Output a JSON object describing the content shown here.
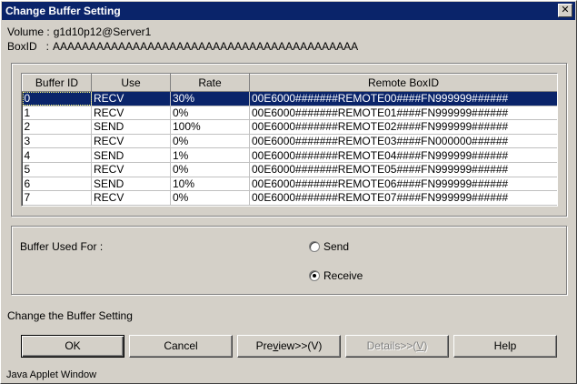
{
  "window": {
    "title": "Change Buffer Setting",
    "close_glyph": "✕"
  },
  "info": {
    "volume_label": "Volume :",
    "volume_value": "g1d10p12@Server1",
    "boxid_label": "BoxID   :",
    "boxid_value": "AAAAAAAAAAAAAAAAAAAAAAAAAAAAAAAAAAAAAAAAAA"
  },
  "table": {
    "columns": [
      "Buffer ID",
      "Use",
      "Rate",
      "Remote BoxID"
    ],
    "rows": [
      [
        "0",
        "RECV",
        "30%",
        "00E6000#######REMOTE00####FN999999######"
      ],
      [
        "1",
        "RECV",
        "0%",
        "00E6000#######REMOTE01####FN999999######"
      ],
      [
        "2",
        "SEND",
        "100%",
        "00E6000#######REMOTE02####FN999999######"
      ],
      [
        "3",
        "RECV",
        "0%",
        "00E6000#######REMOTE03####FN000000######"
      ],
      [
        "4",
        "SEND",
        "1%",
        "00E6000#######REMOTE04####FN999999######"
      ],
      [
        "5",
        "RECV",
        "0%",
        "00E6000#######REMOTE05####FN999999######"
      ],
      [
        "6",
        "SEND",
        "10%",
        "00E6000#######REMOTE06####FN999999######"
      ],
      [
        "7",
        "RECV",
        "0%",
        "00E6000#######REMOTE07####FN999999######"
      ]
    ],
    "selected_row": 0
  },
  "buffer_used_for": {
    "label": "Buffer Used For :",
    "options": [
      "Send",
      "Receive"
    ],
    "selected": "Receive"
  },
  "status": "Change the Buffer Setting",
  "buttons": {
    "ok": "OK",
    "cancel": "Cancel",
    "preview_pre": "Pre",
    "preview_u": "v",
    "preview_post": "iew>>(V)",
    "details_pre": "Details>>(",
    "details_u": "V",
    "details_post": ")",
    "help": "Help"
  },
  "footer": "Java Applet Window",
  "colors": {
    "selection": "#0a246a",
    "titlebar": "#0a246a",
    "face": "#d4d0c8"
  }
}
